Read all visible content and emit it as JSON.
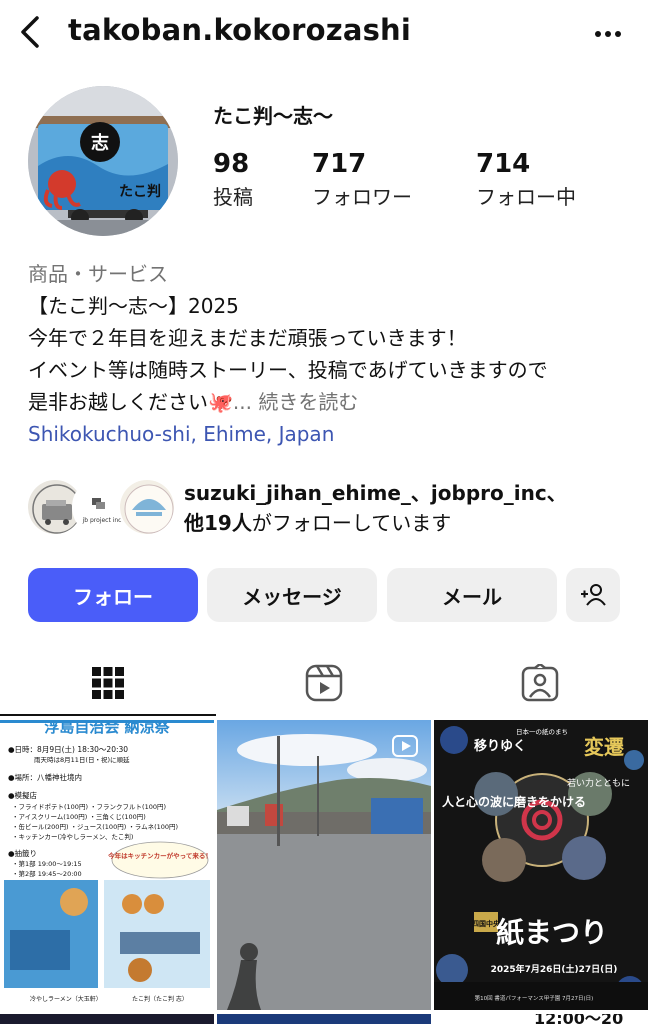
{
  "header": {
    "username": "takoban.kokorozashi",
    "back_icon": "chevron-left-icon",
    "more_icon": "more-horizontal-icon"
  },
  "profile": {
    "display_name": "たこ判〜志〜",
    "avatar_text_1": "志",
    "avatar_text_2": "たこ判",
    "stats": [
      {
        "value": "98",
        "label": "投稿"
      },
      {
        "value": "717",
        "label": "フォロワー"
      },
      {
        "value": "714",
        "label": "フォロー中"
      }
    ]
  },
  "bio": {
    "category": "商品・サービス",
    "line1": "【たこ判〜志〜】2025",
    "line2": "今年で２年目を迎えまだまだ頑張っていきます！",
    "line3": "イベント等は随時ストーリー、投稿であげていきますので",
    "line4": "是非お越しください🐙",
    "ellipsis": "... ",
    "more_label": "続きを読む",
    "location": "Shikokuchuo-shi, Ehime, Japan"
  },
  "followed_by": {
    "names": "suzuki_jihan_ehime_、jobpro_inc、",
    "others_bold": "他19人",
    "suffix": "がフォローしています",
    "avatar2_text": "jb project inc."
  },
  "buttons": {
    "follow": "フォロー",
    "message": "メッセージ",
    "mail": "メール",
    "add_user_icon": "person-add-icon"
  },
  "tabs": [
    {
      "name": "grid",
      "icon": "grid-icon"
    },
    {
      "name": "reels",
      "icon": "reels-icon"
    },
    {
      "name": "tagged",
      "icon": "tagged-person-icon"
    }
  ],
  "posts": {
    "post1": {
      "title": "浮島自治会 納涼祭",
      "line1": "●日時：8月9日(土) 18:30〜20:30",
      "line2": "雨天時は8月11日(日・祝)に順延",
      "line3": "●場所：八幡神社境内",
      "line4": "●模擬店",
      "line5": "・フライドポテト(100円) ・フランクフルト(100円)",
      "line6": "・アイスクリーム(100円) ・三角くじ(100円)",
      "line7": "・缶ビール(200円) ・ジュース(100円) ・ラムネ(100円)",
      "line8": "・キッチンカー(冷やしラーメン、たこ判)",
      "line9": "●抽籤り",
      "line10": "・第1部 19:00〜19:15",
      "line11": "・第2部 19:45〜20:00",
      "callout": "今年はキッチンカーがやって来る！",
      "caption1": "冷やしラーメン（大玉軒）",
      "caption2": "たこ判（たこ判 志）"
    },
    "post3": {
      "top": "日本一の紙のまち",
      "t1": "移りゆく",
      "t2": "変遷",
      "t3": "若い力とともに",
      "t4": "人と心の波に磨きをかける",
      "badge": "四国中央",
      "big": "紙まつり",
      "date": "2025年7月26日(土)27日(日)",
      "footer": "第10回 書道パフォーマンス甲子園 7月27日(日)"
    },
    "bottom_text": "12:00〜20"
  }
}
